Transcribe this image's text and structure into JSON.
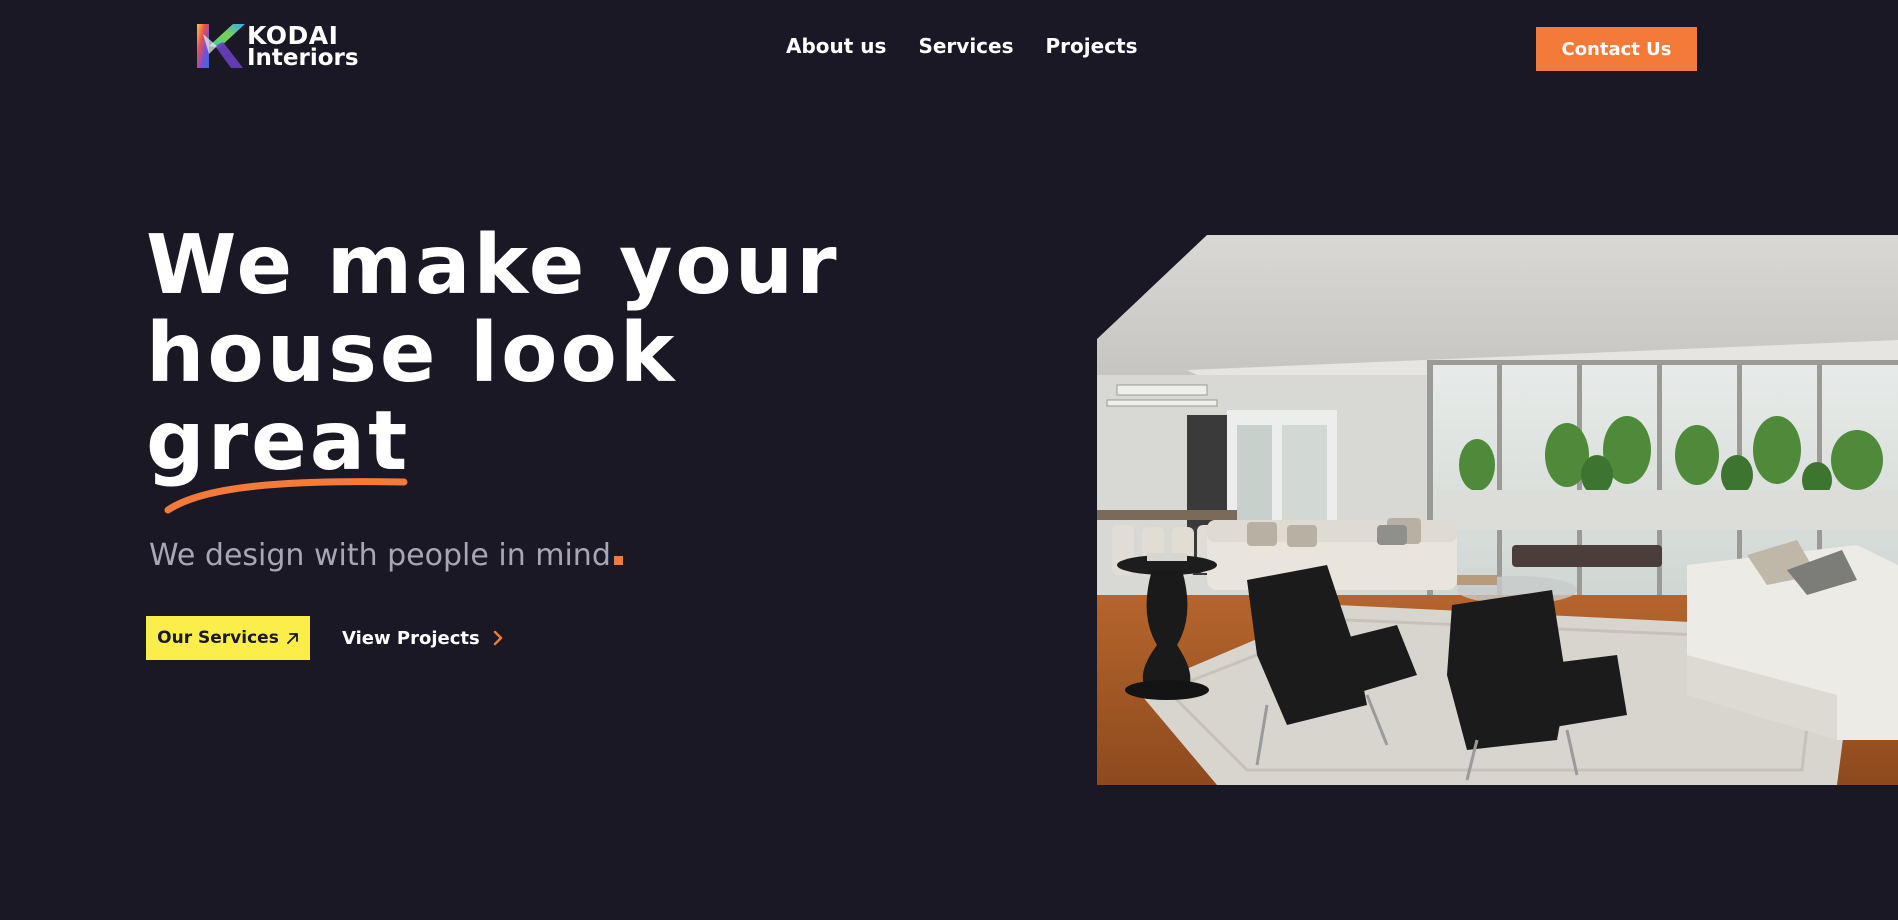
{
  "brand": {
    "name_line1": "KODAI",
    "name_line2": "Interiors",
    "logo_icon": "kodai-k-icon"
  },
  "nav": {
    "items": [
      {
        "label": "About us"
      },
      {
        "label": "Services"
      },
      {
        "label": "Projects"
      }
    ]
  },
  "header": {
    "contact_label": "Contact Us"
  },
  "hero": {
    "title_line1": "We make your",
    "title_line2": "house look",
    "title_line3": "great",
    "tagline": "We design with people in mind",
    "primary_button": "Our Services",
    "primary_icon": "arrow-up-right-icon",
    "secondary_button": "View Projects",
    "secondary_icon": "chevron-right-icon"
  },
  "colors": {
    "background": "#1a1825",
    "accent_orange": "#f47a3a",
    "accent_yellow": "#fcee4a",
    "muted_text": "#a7a6b5"
  }
}
